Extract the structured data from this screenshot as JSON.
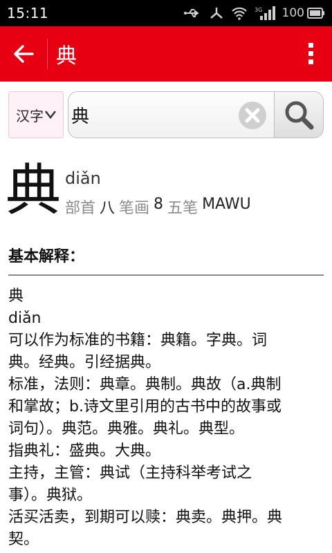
{
  "status_bar": {
    "time": "15:11",
    "battery": "100"
  },
  "app_bar": {
    "title": "典"
  },
  "search": {
    "language": "汉字",
    "query": "典"
  },
  "entry": {
    "character": "典",
    "pinyin": "diǎn",
    "radical_label": "部首",
    "radical": "八",
    "strokes_label": "笔画",
    "strokes": "8",
    "wubi_label": "五笔",
    "wubi": "MAWU"
  },
  "section": {
    "title": "基本解释："
  },
  "definition_lines": [
    "典",
    "diǎn",
    "可以作为标准的书籍：典籍。字典。词",
    "典。经典。引经据典。",
    "标准，法则：典章。典制。典故（a.典制",
    "和掌故；b.诗文里引用的古书中的故事或",
    "词句）。典范。典雅。典礼。典型。",
    "指典礼：盛典。大典。",
    "主持，主管：典试（主持科举考试之",
    "事）。典狱。",
    "活买活卖，到期可以赎：典卖。典押。典",
    "契。"
  ]
}
